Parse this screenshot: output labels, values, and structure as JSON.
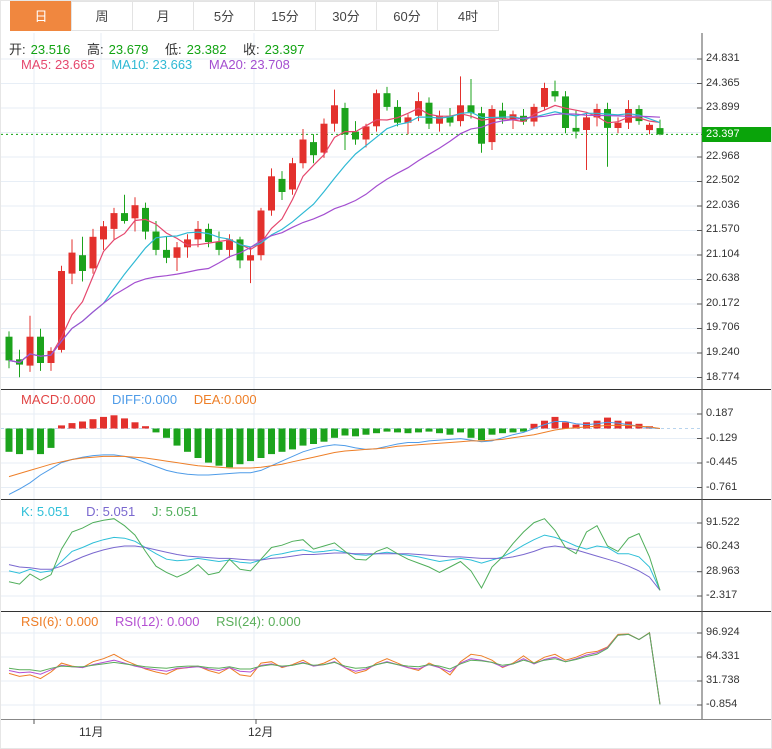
{
  "tabs": {
    "items": [
      {
        "label": "日",
        "selected": true
      },
      {
        "label": "周",
        "selected": false
      },
      {
        "label": "月",
        "selected": false
      },
      {
        "label": "5分",
        "selected": false
      },
      {
        "label": "15分",
        "selected": false
      },
      {
        "label": "30分",
        "selected": false
      },
      {
        "label": "60分",
        "selected": false
      },
      {
        "label": "4时",
        "selected": false
      }
    ]
  },
  "ohlc": {
    "open_label": "开:",
    "open_value": "23.516",
    "high_label": "高:",
    "high_value": "23.679",
    "low_label": "低:",
    "low_value": "23.382",
    "close_label": "收:",
    "close_value": "23.397"
  },
  "ma_header": {
    "ma5": "MA5: 23.665",
    "ma10": "MA10: 23.663",
    "ma20": "MA20: 23.708"
  },
  "macd_header": {
    "macd": "MACD:0.000",
    "diff": "DIFF:0.000",
    "dea": "DEA:0.000"
  },
  "kdj_header": {
    "k": "K: 5.051",
    "d": "D: 5.051",
    "j": "J: 5.051"
  },
  "rsi_header": {
    "rsi6": "RSI(6): 0.000",
    "rsi12": "RSI(12): 0.000",
    "rsi24": "RSI(24): 0.000"
  },
  "price_badge": "23.397",
  "x_axis": {
    "month1": "11月",
    "month2": "12月"
  },
  "colors": {
    "accent_tab": "#f0873f",
    "up": "#e3312d",
    "down": "#1ca31c",
    "price_line": "#12a312",
    "badge": "#0aa40a",
    "ma5": "#e5476d",
    "ma10": "#2fb9d4",
    "ma20": "#a44fd0",
    "diff": "#4f9ce8",
    "dea": "#ee7f28",
    "k": "#2ebfd8",
    "d": "#7a68cf",
    "j": "#4fae5a",
    "rsi6": "#ee7d26",
    "rsi12": "#b44fd2",
    "rsi24": "#5aae5a",
    "grid": "#e7eef6",
    "axis_line": "#555",
    "separator": "#333",
    "zero_line": "#b8d4ee"
  },
  "chart_data": {
    "type": "candlestick+indicators",
    "x_layout": {
      "x0": 8,
      "step": 10.5,
      "plot_right": 701,
      "grid_x": [
        33,
        100,
        253
      ],
      "month_tick_x": [
        33,
        255
      ]
    },
    "separators": [
      388.5,
      498.5,
      610.5
    ],
    "panels": {
      "main": {
        "y_ticks": [
          24.831,
          24.365,
          23.899,
          22.968,
          22.502,
          22.036,
          21.57,
          21.104,
          20.638,
          20.172,
          19.706,
          19.24,
          18.774
        ],
        "gridlines": [
          24.831,
          24.365,
          23.899,
          23.433,
          22.968,
          22.502,
          22.036,
          21.57,
          21.104,
          20.638,
          20.172,
          19.706,
          19.24,
          18.774
        ],
        "axis": {
          "v0": 24.831,
          "y0": 58,
          "v1": 18.774,
          "y1": 376.5
        },
        "last_close": 23.397,
        "ma": [
          {
            "name": "ma5-line",
            "window": 5,
            "color": "#e5476d"
          },
          {
            "name": "ma10-line",
            "window": 10,
            "color": "#2fb9d4"
          },
          {
            "name": "ma20-line",
            "window": 20,
            "color": "#a44fd0"
          }
        ],
        "candles": [
          [
            19.55,
            19.65,
            18.95,
            19.1
          ],
          [
            19.12,
            19.3,
            18.78,
            19.02
          ],
          [
            19.0,
            19.95,
            18.88,
            19.55
          ],
          [
            19.55,
            19.7,
            18.9,
            19.05
          ],
          [
            19.05,
            19.35,
            18.9,
            19.28
          ],
          [
            19.3,
            20.9,
            19.25,
            20.8
          ],
          [
            20.75,
            21.4,
            20.55,
            21.15
          ],
          [
            21.1,
            21.45,
            20.6,
            20.8
          ],
          [
            20.85,
            21.6,
            20.75,
            21.45
          ],
          [
            21.4,
            21.75,
            21.2,
            21.65
          ],
          [
            21.6,
            22.0,
            21.4,
            21.9
          ],
          [
            21.9,
            22.25,
            21.7,
            21.75
          ],
          [
            21.8,
            22.2,
            21.55,
            22.05
          ],
          [
            22.0,
            22.1,
            21.4,
            21.55
          ],
          [
            21.55,
            21.75,
            21.1,
            21.2
          ],
          [
            21.2,
            21.45,
            20.95,
            21.05
          ],
          [
            21.05,
            21.35,
            20.8,
            21.25
          ],
          [
            21.25,
            21.5,
            21.05,
            21.4
          ],
          [
            21.4,
            21.75,
            21.25,
            21.6
          ],
          [
            21.6,
            21.7,
            21.25,
            21.35
          ],
          [
            21.35,
            21.55,
            21.1,
            21.2
          ],
          [
            21.2,
            21.5,
            21.05,
            21.4
          ],
          [
            21.4,
            21.45,
            20.85,
            21.0
          ],
          [
            21.0,
            21.25,
            20.57,
            21.1
          ],
          [
            21.1,
            22.0,
            21.0,
            21.95
          ],
          [
            21.95,
            22.75,
            21.85,
            22.6
          ],
          [
            22.55,
            22.7,
            22.15,
            22.3
          ],
          [
            22.35,
            22.95,
            22.25,
            22.85
          ],
          [
            22.85,
            23.5,
            22.75,
            23.3
          ],
          [
            23.25,
            23.4,
            22.85,
            23.0
          ],
          [
            23.05,
            23.7,
            22.95,
            23.6
          ],
          [
            23.6,
            24.25,
            23.45,
            23.95
          ],
          [
            23.9,
            24.0,
            23.1,
            23.4
          ],
          [
            23.45,
            23.65,
            23.2,
            23.3
          ],
          [
            23.3,
            23.6,
            23.15,
            23.55
          ],
          [
            23.55,
            24.25,
            23.45,
            24.18
          ],
          [
            24.18,
            24.3,
            23.85,
            23.92
          ],
          [
            23.92,
            24.05,
            23.55,
            23.62
          ],
          [
            23.62,
            23.78,
            23.4,
            23.72
          ],
          [
            23.75,
            24.2,
            23.65,
            24.03
          ],
          [
            24.0,
            24.1,
            23.5,
            23.6
          ],
          [
            23.6,
            23.85,
            23.45,
            23.75
          ],
          [
            23.75,
            23.9,
            23.55,
            23.62
          ],
          [
            23.65,
            24.5,
            23.55,
            23.95
          ],
          [
            23.95,
            24.45,
            23.7,
            23.8
          ],
          [
            23.8,
            23.92,
            23.05,
            23.22
          ],
          [
            23.25,
            23.95,
            23.1,
            23.88
          ],
          [
            23.85,
            24.0,
            23.6,
            23.68
          ],
          [
            23.68,
            23.85,
            23.5,
            23.78
          ],
          [
            23.75,
            23.88,
            23.58,
            23.64
          ],
          [
            23.64,
            23.98,
            23.55,
            23.92
          ],
          [
            23.92,
            24.38,
            23.85,
            24.28
          ],
          [
            24.22,
            24.42,
            24.02,
            24.12
          ],
          [
            24.12,
            24.22,
            23.42,
            23.52
          ],
          [
            23.52,
            23.85,
            23.32,
            23.45
          ],
          [
            23.48,
            23.8,
            22.72,
            23.72
          ],
          [
            23.72,
            23.98,
            23.55,
            23.88
          ],
          [
            23.88,
            24.0,
            22.78,
            23.52
          ],
          [
            23.52,
            23.72,
            23.42,
            23.62
          ],
          [
            23.62,
            24.05,
            23.5,
            23.88
          ],
          [
            23.88,
            23.95,
            23.58,
            23.65
          ],
          [
            23.48,
            23.62,
            23.4,
            23.58
          ],
          [
            23.516,
            23.679,
            23.382,
            23.397
          ]
        ]
      },
      "macd": {
        "y_ticks": [
          0.187,
          -0.129,
          -0.445,
          -0.761
        ],
        "axis": {
          "v0": 0.187,
          "y0": 413,
          "v1": -0.761,
          "y1": 486.5
        },
        "bars": [
          -0.3,
          -0.33,
          -0.28,
          -0.33,
          -0.25,
          0.04,
          0.07,
          0.09,
          0.12,
          0.15,
          0.17,
          0.13,
          0.08,
          0.03,
          -0.05,
          -0.12,
          -0.22,
          -0.3,
          -0.38,
          -0.44,
          -0.48,
          -0.5,
          -0.46,
          -0.42,
          -0.38,
          -0.33,
          -0.3,
          -0.27,
          -0.22,
          -0.2,
          -0.17,
          -0.12,
          -0.09,
          -0.1,
          -0.08,
          -0.06,
          -0.04,
          -0.05,
          -0.06,
          -0.05,
          -0.04,
          -0.06,
          -0.08,
          -0.05,
          -0.12,
          -0.15,
          -0.08,
          -0.06,
          -0.05,
          -0.04,
          0.06,
          0.1,
          0.15,
          0.08,
          0.05,
          0.08,
          0.1,
          0.14,
          0.1,
          0.09,
          0.06,
          0.03,
          0.0
        ],
        "diff": [
          -0.85,
          -0.78,
          -0.7,
          -0.6,
          -0.52,
          -0.44,
          -0.4,
          -0.37,
          -0.35,
          -0.34,
          -0.34,
          -0.36,
          -0.39,
          -0.44,
          -0.49,
          -0.54,
          -0.57,
          -0.59,
          -0.6,
          -0.6,
          -0.59,
          -0.58,
          -0.57,
          -0.57,
          -0.54,
          -0.48,
          -0.42,
          -0.36,
          -0.3,
          -0.26,
          -0.23,
          -0.21,
          -0.22,
          -0.25,
          -0.27,
          -0.26,
          -0.23,
          -0.2,
          -0.18,
          -0.18,
          -0.16,
          -0.15,
          -0.14,
          -0.13,
          -0.15,
          -0.17,
          -0.16,
          -0.12,
          -0.08,
          -0.05,
          0.0,
          0.05,
          0.09,
          0.09,
          0.06,
          0.05,
          0.06,
          0.08,
          0.07,
          0.05,
          0.03,
          0.01,
          0.0
        ],
        "dea": [
          -0.62,
          -0.58,
          -0.54,
          -0.5,
          -0.46,
          -0.43,
          -0.4,
          -0.38,
          -0.37,
          -0.36,
          -0.36,
          -0.36,
          -0.37,
          -0.38,
          -0.4,
          -0.42,
          -0.44,
          -0.46,
          -0.48,
          -0.49,
          -0.5,
          -0.51,
          -0.51,
          -0.51,
          -0.5,
          -0.48,
          -0.46,
          -0.43,
          -0.4,
          -0.37,
          -0.34,
          -0.31,
          -0.29,
          -0.28,
          -0.27,
          -0.26,
          -0.25,
          -0.23,
          -0.22,
          -0.21,
          -0.2,
          -0.19,
          -0.18,
          -0.17,
          -0.16,
          -0.16,
          -0.15,
          -0.14,
          -0.12,
          -0.1,
          -0.08,
          -0.05,
          -0.02,
          0.0,
          0.01,
          0.02,
          0.03,
          0.04,
          0.04,
          0.04,
          0.03,
          0.02,
          0.0
        ]
      },
      "kdj": {
        "y_ticks": [
          91.522,
          60.243,
          28.963,
          -2.317
        ],
        "axis": {
          "v0": 91.522,
          "y0": 522,
          "v1": -2.317,
          "y1": 595
        },
        "k": [
          30,
          27,
          32,
          28,
          30,
          42,
          55,
          60,
          66,
          70,
          73,
          72,
          68,
          60,
          52,
          45,
          43,
          44,
          46,
          44,
          42,
          44,
          41,
          40,
          44,
          50,
          52,
          55,
          57,
          54,
          55,
          57,
          54,
          51,
          50,
          52,
          54,
          52,
          50,
          48,
          45,
          42,
          44,
          46,
          44,
          40,
          44,
          48,
          55,
          63,
          70,
          76,
          73,
          68,
          62,
          58,
          62,
          60,
          52,
          52,
          48,
          35,
          5.051
        ],
        "d": [
          38,
          35,
          34,
          32,
          32,
          36,
          42,
          48,
          53,
          57,
          60,
          62,
          62,
          60,
          57,
          54,
          51,
          49,
          48,
          47,
          46,
          46,
          45,
          44,
          44,
          46,
          47,
          49,
          51,
          51,
          52,
          53,
          53,
          52,
          52,
          52,
          52,
          52,
          52,
          51,
          50,
          49,
          48,
          48,
          47,
          46,
          46,
          46,
          48,
          51,
          55,
          60,
          62,
          60,
          57,
          53,
          49,
          45,
          41,
          36,
          30,
          22,
          5.051
        ],
        "j": [
          16,
          13,
          26,
          18,
          25,
          58,
          80,
          85,
          92,
          95,
          97,
          88,
          76,
          55,
          36,
          28,
          22,
          28,
          38,
          25,
          28,
          45,
          32,
          30,
          45,
          60,
          63,
          68,
          70,
          58,
          62,
          66,
          55,
          45,
          44,
          55,
          60,
          52,
          45,
          40,
          35,
          28,
          35,
          42,
          30,
          8,
          35,
          48,
          65,
          80,
          92,
          97,
          82,
          60,
          52,
          80,
          88,
          62,
          55,
          72,
          78,
          48,
          5.051
        ]
      },
      "rsi": {
        "y_ticks": [
          96.924,
          64.331,
          31.738,
          -0.854
        ],
        "axis": {
          "v0": 96.924,
          "y0": 632,
          "v1": -0.854,
          "y1": 704
        },
        "rsi6": [
          42,
          38,
          40,
          35,
          44,
          56,
          52,
          50,
          58,
          62,
          68,
          60,
          54,
          48,
          44,
          41,
          48,
          50,
          52,
          46,
          42,
          50,
          40,
          38,
          56,
          58,
          50,
          54,
          60,
          52,
          56,
          63,
          50,
          42,
          46,
          56,
          62,
          56,
          50,
          46,
          56,
          50,
          40,
          58,
          68,
          66,
          60,
          50,
          56,
          66,
          56,
          64,
          68,
          60,
          64,
          70,
          72,
          78,
          95,
          95.5,
          88,
          97.5,
          0
        ],
        "rsi12": [
          46,
          43,
          44,
          41,
          47,
          53,
          51,
          50,
          54,
          57,
          60,
          56,
          52,
          49,
          47,
          45,
          49,
          50,
          51,
          48,
          46,
          50,
          45,
          44,
          53,
          55,
          51,
          53,
          57,
          52,
          54,
          58,
          50,
          45,
          48,
          54,
          58,
          54,
          50,
          48,
          54,
          50,
          44,
          56,
          62,
          60,
          57,
          51,
          55,
          62,
          55,
          61,
          64,
          58,
          62,
          67,
          70,
          77,
          94,
          95,
          88,
          97,
          0
        ],
        "rsi24": [
          49,
          47,
          47,
          45,
          49,
          52,
          51,
          51,
          53,
          55,
          57,
          55,
          53,
          51,
          50,
          49,
          51,
          52,
          52,
          50,
          49,
          51,
          48,
          48,
          52,
          54,
          52,
          53,
          56,
          53,
          54,
          57,
          52,
          49,
          50,
          54,
          57,
          54,
          52,
          51,
          54,
          52,
          48,
          55,
          60,
          59,
          57,
          53,
          55,
          60,
          56,
          60,
          62,
          58,
          61,
          65,
          68,
          76,
          94,
          95,
          88,
          97,
          0
        ]
      }
    }
  }
}
